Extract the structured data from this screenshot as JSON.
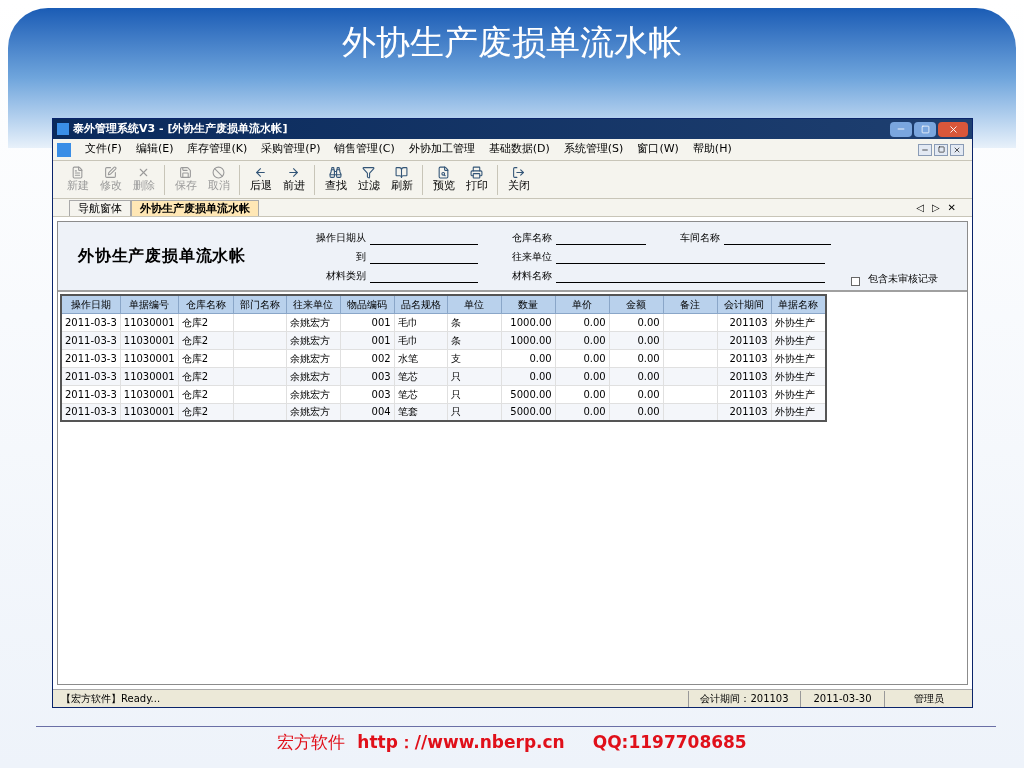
{
  "slide_title": "外协生产废损单流水帐",
  "window": {
    "title": "泰外管理系统V3 - [外协生产废损单流水帐]"
  },
  "menu": [
    "文件(F)",
    "编辑(E)",
    "库存管理(K)",
    "采购管理(P)",
    "销售管理(C)",
    "外协加工管理",
    "基础数据(D)",
    "系统管理(S)",
    "窗口(W)",
    "帮助(H)"
  ],
  "toolbar": [
    {
      "kind": "new",
      "label": "新建",
      "disabled": true
    },
    {
      "kind": "edit",
      "label": "修改",
      "disabled": true
    },
    {
      "kind": "delete",
      "label": "删除",
      "disabled": true
    },
    {
      "kind": "save",
      "label": "保存",
      "disabled": true
    },
    {
      "kind": "cancel",
      "label": "取消",
      "disabled": true
    },
    {
      "kind": "back",
      "label": "后退",
      "disabled": false
    },
    {
      "kind": "forward",
      "label": "前进",
      "disabled": false
    },
    {
      "kind": "find",
      "label": "查找",
      "disabled": false
    },
    {
      "kind": "filter",
      "label": "过滤",
      "disabled": false
    },
    {
      "kind": "refresh",
      "label": "刷新",
      "disabled": false
    },
    {
      "kind": "preview",
      "label": "预览",
      "disabled": false
    },
    {
      "kind": "print",
      "label": "打印",
      "disabled": false
    },
    {
      "kind": "close",
      "label": "关闭",
      "disabled": false
    }
  ],
  "tabs": [
    {
      "label": "导航窗体",
      "selected": false
    },
    {
      "label": "外协生产废损单流水帐",
      "selected": true
    }
  ],
  "tab_controls": [
    "◁",
    "▷",
    "✕"
  ],
  "report_title": "外协生产废损单流水帐",
  "filters": [
    {
      "label": "操作日期从"
    },
    {
      "label": "到"
    },
    {
      "label": "材料类别"
    },
    {
      "label": "仓库名称"
    },
    {
      "label": "往来单位"
    },
    {
      "label": "材料名称"
    },
    {
      "label": "车间名称"
    }
  ],
  "include_unaudited": {
    "label": "包含未审核记录",
    "checked": false
  },
  "table": {
    "columns": [
      "操作日期",
      "单据编号",
      "仓库名称",
      "部门名称",
      "往来单位",
      "物品编码",
      "品名规格",
      "单位",
      "数量",
      "单价",
      "金额",
      "备注",
      "会计期间",
      "单据名称"
    ],
    "rows": [
      [
        "2011-03-3",
        "11030001",
        "仓库2",
        "",
        "余姚宏方",
        "001",
        "毛巾",
        "条",
        "1000.00",
        "0.00",
        "0.00",
        "",
        "201103",
        "外协生产"
      ],
      [
        "2011-03-3",
        "11030001",
        "仓库2",
        "",
        "余姚宏方",
        "001",
        "毛巾",
        "条",
        "1000.00",
        "0.00",
        "0.00",
        "",
        "201103",
        "外协生产"
      ],
      [
        "2011-03-3",
        "11030001",
        "仓库2",
        "",
        "余姚宏方",
        "002",
        "水笔",
        "支",
        "0.00",
        "0.00",
        "0.00",
        "",
        "201103",
        "外协生产"
      ],
      [
        "2011-03-3",
        "11030001",
        "仓库2",
        "",
        "余姚宏方",
        "003",
        "笔芯",
        "只",
        "0.00",
        "0.00",
        "0.00",
        "",
        "201103",
        "外协生产"
      ],
      [
        "2011-03-3",
        "11030001",
        "仓库2",
        "",
        "余姚宏方",
        "003",
        "笔芯",
        "只",
        "5000.00",
        "0.00",
        "0.00",
        "",
        "201103",
        "外协生产"
      ],
      [
        "2011-03-3",
        "11030001",
        "仓库2",
        "",
        "余姚宏方",
        "004",
        "笔套",
        "只",
        "5000.00",
        "0.00",
        "0.00",
        "",
        "201103",
        "外协生产"
      ]
    ]
  },
  "status_bar": [
    "【宏方软件】Ready...",
    "会计期间：201103",
    "2011-03-30",
    "管理员"
  ],
  "footer": {
    "company": "宏方软件",
    "url": "http：//www.nberp.cn",
    "qq": "QQ:1197708685"
  }
}
